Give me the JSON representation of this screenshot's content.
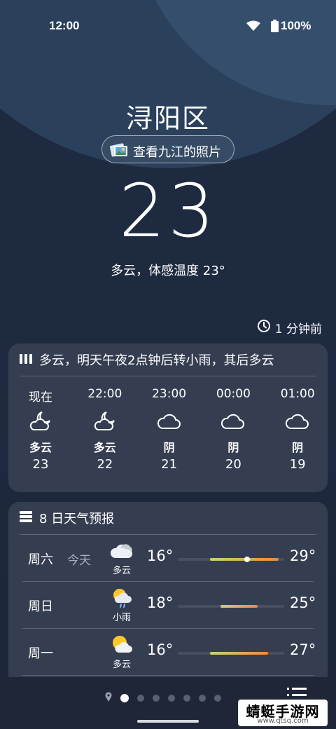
{
  "status_bar": {
    "time": "12:00",
    "battery": "100%"
  },
  "location": {
    "name": "浔阳区",
    "photos_label": "查看九江的照片"
  },
  "current": {
    "temperature": "23",
    "condition": "多云，体感温度 23°"
  },
  "updated": "1 分钟前",
  "hourly": {
    "summary": "多云，明天午夜2点钟后转小雨，其后多云",
    "hours": [
      {
        "time": "现在",
        "icon": "partly-cloudy-night-icon",
        "desc": "多云",
        "temp": "23"
      },
      {
        "time": "22:00",
        "icon": "partly-cloudy-night-icon",
        "desc": "多云",
        "temp": "22"
      },
      {
        "time": "23:00",
        "icon": "cloud-icon",
        "desc": "阴",
        "temp": "21"
      },
      {
        "time": "00:00",
        "icon": "cloud-icon",
        "desc": "阴",
        "temp": "20"
      },
      {
        "time": "01:00",
        "icon": "cloud-icon",
        "desc": "阴",
        "temp": "19"
      }
    ]
  },
  "daily": {
    "title": "8 日天气预报",
    "scale": {
      "min": 10,
      "max": 30
    },
    "days": [
      {
        "name": "周六",
        "tag": "今天",
        "icon": "cloudy-icon",
        "desc": "多云",
        "low": "16°",
        "high": "29°",
        "low_value": 16,
        "high_value": 29,
        "current_value": 23
      },
      {
        "name": "周日",
        "tag": "",
        "icon": "light-rain-icon",
        "desc": "小雨",
        "low": "18°",
        "high": "25°",
        "low_value": 18,
        "high_value": 25
      },
      {
        "name": "周一",
        "tag": "",
        "icon": "partly-sunny-icon",
        "desc": "多云",
        "low": "16°",
        "high": "27°",
        "low_value": 16,
        "high_value": 27
      }
    ]
  },
  "colors": {
    "card": "#353e51",
    "background": "#1c2a40",
    "bar_cool": "#c8d27a",
    "bar_warm": "#f08a3a"
  },
  "pager": {
    "count": 7,
    "active": 0
  },
  "watermark": {
    "line1": "蜻蜓手游网",
    "line2": "www.qtsq.com"
  }
}
